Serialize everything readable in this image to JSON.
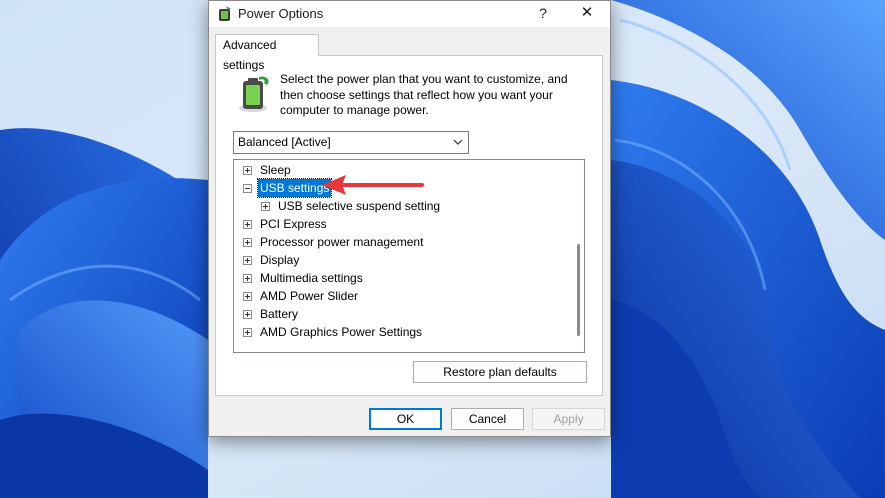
{
  "window": {
    "title": "Power Options",
    "help_glyph": "?",
    "close_glyph": "✕"
  },
  "tab": {
    "label": "Advanced settings"
  },
  "description": "Select the power plan that you want to customize, and then choose settings that reflect how you want your computer to manage power.",
  "plan_select": {
    "value": "Balanced [Active]"
  },
  "tree": {
    "items": [
      {
        "label": "Sleep",
        "expander": "plus",
        "selected": false,
        "level": 0
      },
      {
        "label": "USB settings",
        "expander": "minus",
        "selected": true,
        "level": 0
      },
      {
        "label": "USB selective suspend setting",
        "expander": "plus",
        "selected": false,
        "level": 1
      },
      {
        "label": "PCI Express",
        "expander": "plus",
        "selected": false,
        "level": 0
      },
      {
        "label": "Processor power management",
        "expander": "plus",
        "selected": false,
        "level": 0
      },
      {
        "label": "Display",
        "expander": "plus",
        "selected": false,
        "level": 0
      },
      {
        "label": "Multimedia settings",
        "expander": "plus",
        "selected": false,
        "level": 0
      },
      {
        "label": "AMD Power Slider",
        "expander": "plus",
        "selected": false,
        "level": 0
      },
      {
        "label": "Battery",
        "expander": "plus",
        "selected": false,
        "level": 0
      },
      {
        "label": "AMD Graphics Power Settings",
        "expander": "plus",
        "selected": false,
        "level": 0
      }
    ]
  },
  "buttons": {
    "restore": "Restore plan defaults",
    "ok": "OK",
    "cancel": "Cancel",
    "apply": "Apply"
  },
  "annotation": {
    "arrow_color": "#e8383d"
  },
  "colors": {
    "selection": "#0078d7",
    "wallpaper": "#0a3fb8"
  },
  "icons": [
    "battery-power-icon",
    "chevron-down-icon",
    "help-icon",
    "close-icon"
  ]
}
